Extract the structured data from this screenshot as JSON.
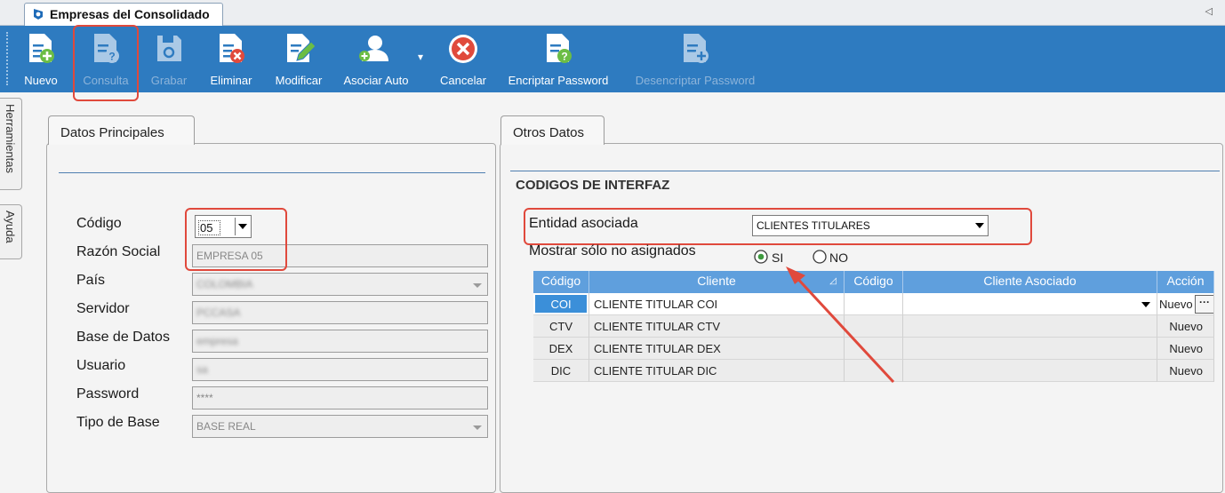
{
  "window": {
    "tab_title": "Empresas del Consolidado"
  },
  "toolbar": [
    {
      "id": "nuevo",
      "label": "Nuevo",
      "icon": "document-add-icon",
      "enabled": true
    },
    {
      "id": "consulta",
      "label": "Consulta",
      "icon": "document-query-icon",
      "enabled": false
    },
    {
      "id": "grabar",
      "label": "Grabar",
      "icon": "save-icon",
      "enabled": false
    },
    {
      "id": "eliminar",
      "label": "Eliminar",
      "icon": "document-delete-icon",
      "enabled": true
    },
    {
      "id": "modificar",
      "label": "Modificar",
      "icon": "document-edit-icon",
      "enabled": true
    },
    {
      "id": "asociar_auto",
      "label": "Asociar Auto",
      "icon": "user-add-icon",
      "enabled": true
    },
    {
      "id": "cancelar",
      "label": "Cancelar",
      "icon": "cancel-icon",
      "enabled": true
    },
    {
      "id": "encriptar",
      "label": "Encriptar Password",
      "icon": "document-query-icon",
      "enabled": true
    },
    {
      "id": "desencriptar",
      "label": "Desencriptar Password",
      "icon": "document-add-icon",
      "enabled": false
    }
  ],
  "side_tabs": [
    "Herramientas",
    "Ayuda"
  ],
  "datos_principales": {
    "tab_label": "Datos Principales",
    "labels": {
      "codigo": "Código",
      "razon_social": "Razón Social",
      "pais": "País",
      "servidor": "Servidor",
      "base_datos": "Base de Datos",
      "usuario": "Usuario",
      "password": "Password",
      "tipo_base": "Tipo de Base"
    },
    "values": {
      "codigo": "05",
      "razon_social": "EMPRESA 05",
      "pais": "COLOMBIA",
      "servidor": "PCCASA",
      "base_datos": "empresa",
      "usuario": "sa",
      "password": "****",
      "tipo_base": "BASE REAL"
    }
  },
  "otros_datos": {
    "tab_label": "Otros Datos",
    "section_title": "CODIGOS DE INTERFAZ",
    "entidad_label": "Entidad asociada",
    "entidad_value": "CLIENTES TITULARES",
    "mostrar_label": "Mostrar sólo no asignados",
    "radio_si": "SI",
    "radio_no": "NO",
    "radio_selected": "SI"
  },
  "grid": {
    "headers": [
      "Código",
      "Cliente",
      "Código",
      "Cliente Asociado",
      "Acción"
    ],
    "rows": [
      {
        "codigo": "COI",
        "cliente": "CLIENTE TITULAR COI",
        "codigo2": "",
        "asociado": "",
        "accion": "Nuevo"
      },
      {
        "codigo": "CTV",
        "cliente": "CLIENTE TITULAR CTV",
        "codigo2": "",
        "asociado": "",
        "accion": "Nuevo"
      },
      {
        "codigo": "DEX",
        "cliente": "CLIENTE TITULAR DEX",
        "codigo2": "",
        "asociado": "",
        "accion": "Nuevo"
      },
      {
        "codigo": "DIC",
        "cliente": "CLIENTE TITULAR DIC",
        "codigo2": "",
        "asociado": "",
        "accion": "Nuevo"
      }
    ],
    "selected_row": 0,
    "ellipsis": "···"
  },
  "colors": {
    "toolbar": "#2e7bc0",
    "highlight": "#e0493c",
    "grid_header": "#5f9fdd",
    "selected_cell": "#3b8fd9"
  }
}
